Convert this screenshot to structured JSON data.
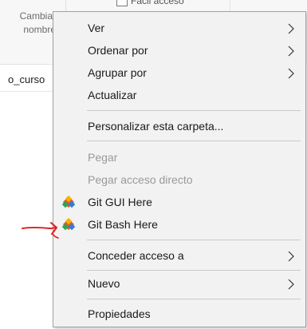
{
  "background": {
    "rename_label": "Cambiar nombre",
    "quick_access_label": "Fácil acceso",
    "path_fragment": "o_curso"
  },
  "menu": {
    "items": [
      {
        "label": "Ver",
        "has_submenu": true,
        "enabled": true
      },
      {
        "label": "Ordenar por",
        "has_submenu": true,
        "enabled": true
      },
      {
        "label": "Agrupar por",
        "has_submenu": true,
        "enabled": true
      },
      {
        "label": "Actualizar",
        "has_submenu": false,
        "enabled": true
      },
      {
        "label": "Personalizar esta carpeta...",
        "has_submenu": false,
        "enabled": true
      },
      {
        "label": "Pegar",
        "has_submenu": false,
        "enabled": false
      },
      {
        "label": "Pegar acceso directo",
        "has_submenu": false,
        "enabled": false
      },
      {
        "label": "Git GUI Here",
        "has_submenu": false,
        "enabled": true,
        "icon": "git-icon"
      },
      {
        "label": "Git Bash Here",
        "has_submenu": false,
        "enabled": true,
        "icon": "git-icon"
      },
      {
        "label": "Conceder acceso a",
        "has_submenu": true,
        "enabled": true
      },
      {
        "label": "Nuevo",
        "has_submenu": true,
        "enabled": true
      },
      {
        "label": "Propiedades",
        "has_submenu": false,
        "enabled": true
      }
    ]
  },
  "annotation": {
    "icon": "red-arrow-icon",
    "color": "#e01e1e"
  },
  "colors": {
    "menu_bg": "#f2f2f2",
    "disabled_text": "#9a9a9a",
    "separator": "#c9c9c9"
  }
}
